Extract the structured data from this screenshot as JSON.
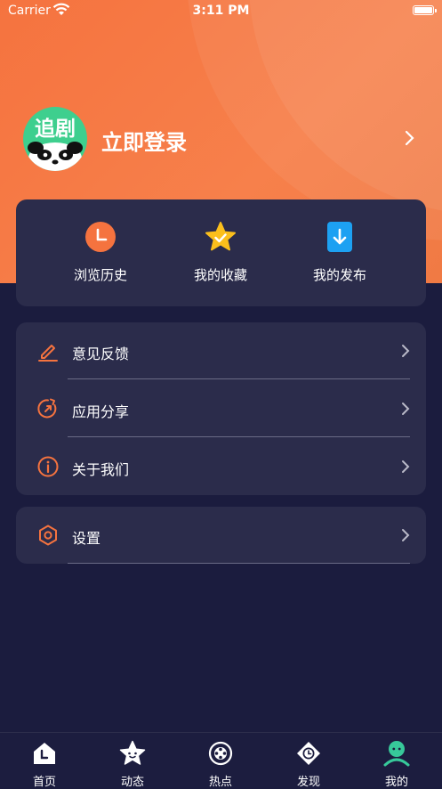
{
  "status_bar": {
    "carrier": "Carrier",
    "time": "3:11 PM"
  },
  "profile": {
    "avatar_text": "追剧",
    "login_label": "立即登录"
  },
  "quick_actions": [
    {
      "label": "浏览历史",
      "icon": "clock-icon"
    },
    {
      "label": "我的收藏",
      "icon": "star-icon"
    },
    {
      "label": "我的发布",
      "icon": "download-icon"
    }
  ],
  "menu": [
    {
      "label": "意见反馈",
      "icon": "pencil-icon"
    },
    {
      "label": "应用分享",
      "icon": "share-icon"
    },
    {
      "label": "关于我们",
      "icon": "info-icon"
    }
  ],
  "settings": {
    "label": "设置",
    "icon": "hexagon-gear-icon"
  },
  "tabs": [
    {
      "label": "首页",
      "icon": "home-icon"
    },
    {
      "label": "动态",
      "icon": "star-face-icon"
    },
    {
      "label": "热点",
      "icon": "film-reel-icon"
    },
    {
      "label": "发现",
      "icon": "eye-clock-icon"
    },
    {
      "label": "我的",
      "icon": "user-icon",
      "active": true
    }
  ],
  "colors": {
    "accent": "#f5733f",
    "background": "#1b1c3e",
    "card": "#2b2c4b",
    "active_tab": "#37c99a"
  }
}
